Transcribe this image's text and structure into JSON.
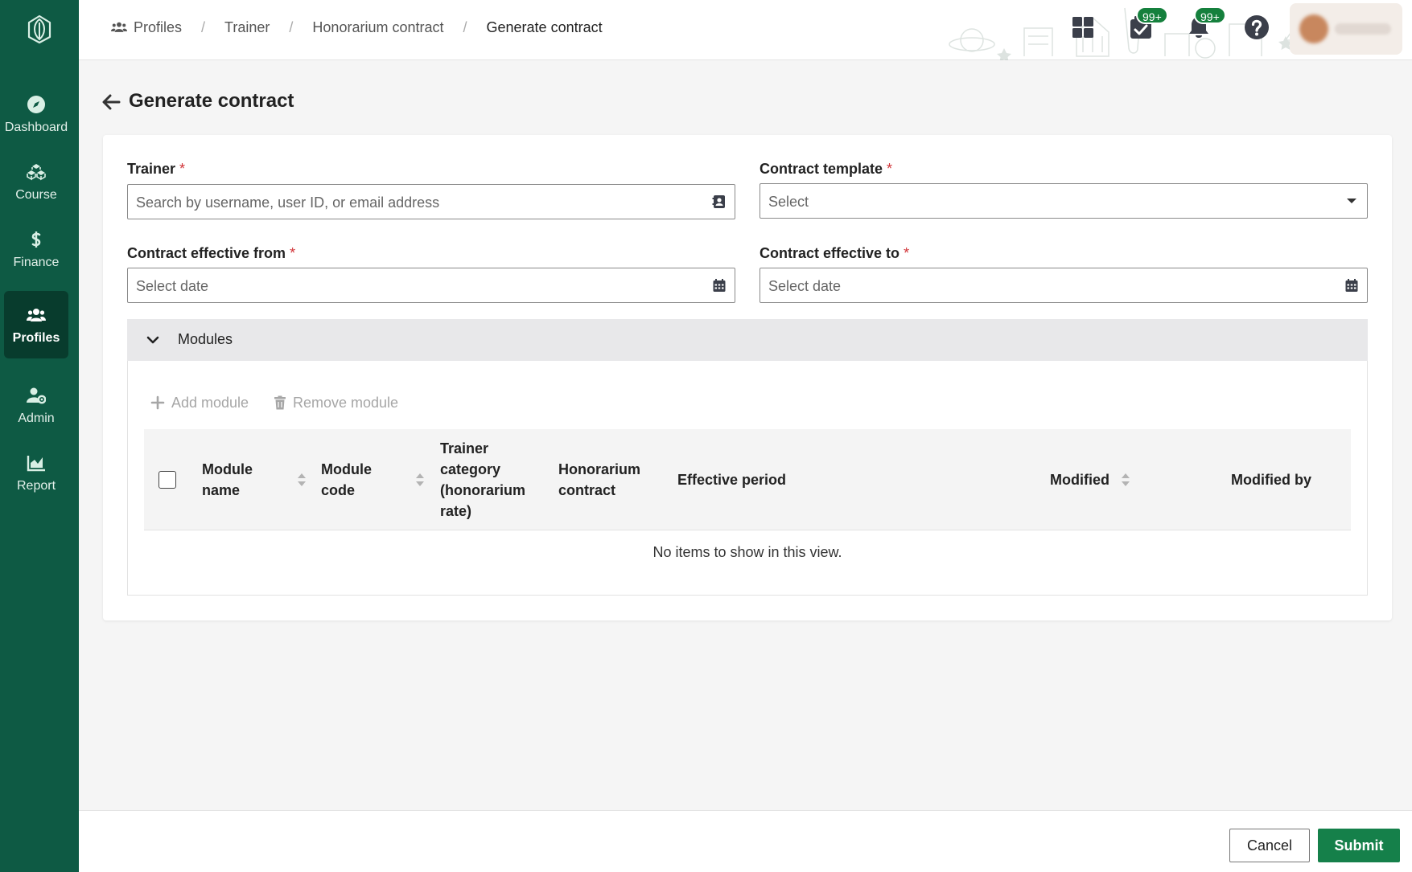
{
  "colors": {
    "sidebar": "#0e5a44",
    "sidebar_active": "#083c2d",
    "primary": "#15804a",
    "required": "#d13438",
    "badge": "#15803d"
  },
  "sidebar": {
    "logo_icon": "leaf-book-icon",
    "items": [
      {
        "label": "Dashboard",
        "icon": "compass-icon",
        "active": false
      },
      {
        "label": "Course",
        "icon": "cubes-icon",
        "active": false
      },
      {
        "label": "Finance",
        "icon": "dollar-icon",
        "active": false
      },
      {
        "label": "Profiles",
        "icon": "users-icon",
        "active": true
      },
      {
        "label": "Admin",
        "icon": "user-gear-icon",
        "active": false
      },
      {
        "label": "Report",
        "icon": "area-chart-icon",
        "active": false
      }
    ]
  },
  "header": {
    "breadcrumb": [
      {
        "label": "Profiles",
        "icon": "users-icon"
      },
      {
        "label": "Trainer"
      },
      {
        "label": "Honorarium contract"
      },
      {
        "label": "Generate contract"
      }
    ],
    "tasks_badge": "99+",
    "notifications_badge": "99+"
  },
  "page": {
    "title": "Generate contract"
  },
  "form": {
    "trainer": {
      "label": "Trainer",
      "required": "*",
      "placeholder": "Search by username, user ID, or email address"
    },
    "contract_template": {
      "label": "Contract template",
      "required": "*",
      "placeholder": "Select"
    },
    "effective_from": {
      "label": "Contract effective from",
      "required": "*",
      "placeholder": "Select date"
    },
    "effective_to": {
      "label": "Contract effective to",
      "required": "*",
      "placeholder": "Select date"
    }
  },
  "modules": {
    "title": "Modules",
    "add_label": "Add module",
    "remove_label": "Remove module",
    "columns": {
      "module_name": [
        "Module",
        "name"
      ],
      "module_code": [
        "Module",
        "code"
      ],
      "trainer_category": [
        "Trainer",
        "category",
        "(honorarium",
        "rate)"
      ],
      "honorarium_contract": [
        "Honorarium",
        "contract"
      ],
      "effective_period": "Effective period",
      "modified": "Modified",
      "modified_by": "Modified by"
    },
    "empty_message": "No items to show in this view."
  },
  "footer": {
    "cancel_label": "Cancel",
    "submit_label": "Submit"
  }
}
